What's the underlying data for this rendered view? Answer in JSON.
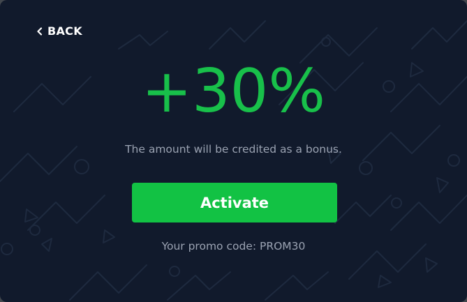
{
  "modal": {
    "back_label": "BACK",
    "headline": "+30%",
    "subtext": "The amount will be credited as a bonus.",
    "activate_label": "Activate",
    "promo_text": "Your promo code: PROM30"
  },
  "colors": {
    "background": "#111a2c",
    "accent_green": "#12c244",
    "muted_text": "#9ba3b2"
  }
}
